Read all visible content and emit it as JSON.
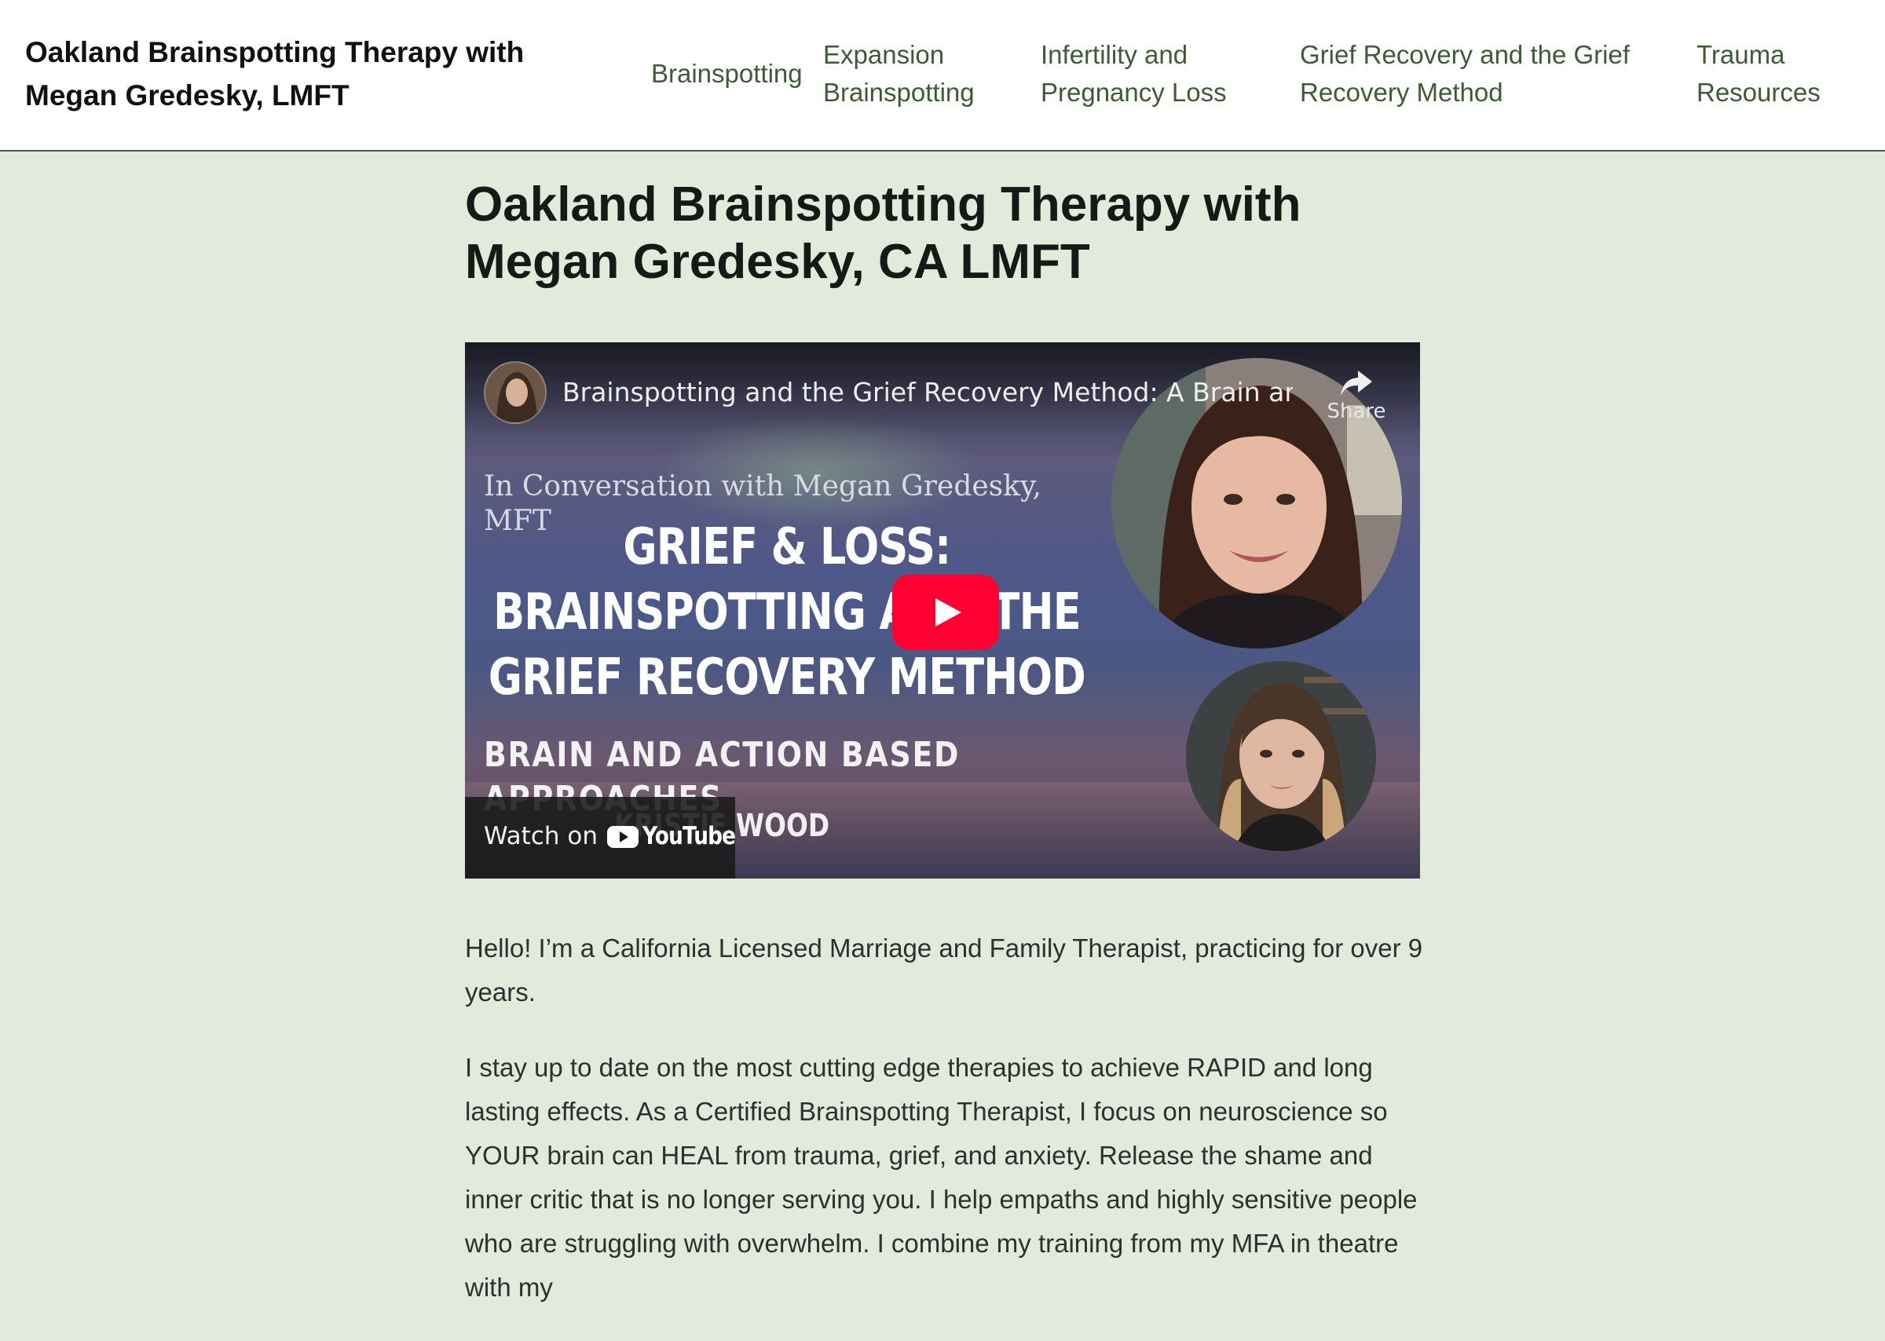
{
  "site": {
    "title": "Oakland Brainspotting Therapy with Megan Gredesky, LMFT"
  },
  "nav": {
    "items": [
      {
        "label": "Brainspotting"
      },
      {
        "label": "Expansion Brainspotting"
      },
      {
        "label": "Infertility and Pregnancy Loss"
      },
      {
        "label": "Grief Recovery and the Grief Recovery Method"
      },
      {
        "label": "Trauma Resources"
      }
    ]
  },
  "page": {
    "title": "Oakland Brainspotting Therapy with Megan Gredesky, CA LMFT"
  },
  "video": {
    "title": "Brainspotting and the Grief Recovery Method: A Brain an...",
    "share_label": "Share",
    "thumb_line1": "In Conversation with Megan Gredesky, MFT",
    "thumb_title": "GRIEF & LOSS: BRAINSPOTTING AND THE GRIEF RECOVERY METHOD",
    "thumb_subtitle": "BRAIN AND ACTION BASED APPROACHES",
    "thumb_guest": "KRISTIE WOOD",
    "watch_on_label": "Watch on",
    "youtube_label": "YouTube",
    "play_color": "#ff0033"
  },
  "body": {
    "paragraphs": [
      "Hello! I’m a California Licensed Marriage and Family Therapist, practicing for over 9 years.",
      "I stay up to date on the most cutting edge therapies to achieve RAPID and long lasting effects.  As a Certified Brainspotting Therapist, I focus on neuroscience so YOUR brain can HEAL from trauma, grief, and anxiety. Release the shame and inner critic that is no longer serving you.  I help empaths and highly sensitive people who are struggling with overwhelm.  I combine my training from my MFA in theatre with my"
    ]
  },
  "colors": {
    "page_background": "#e1eadb",
    "header_background": "#ffffff",
    "nav_link": "#3e5a37",
    "heading": "#161a16",
    "body_text": "#2f2f2f"
  }
}
